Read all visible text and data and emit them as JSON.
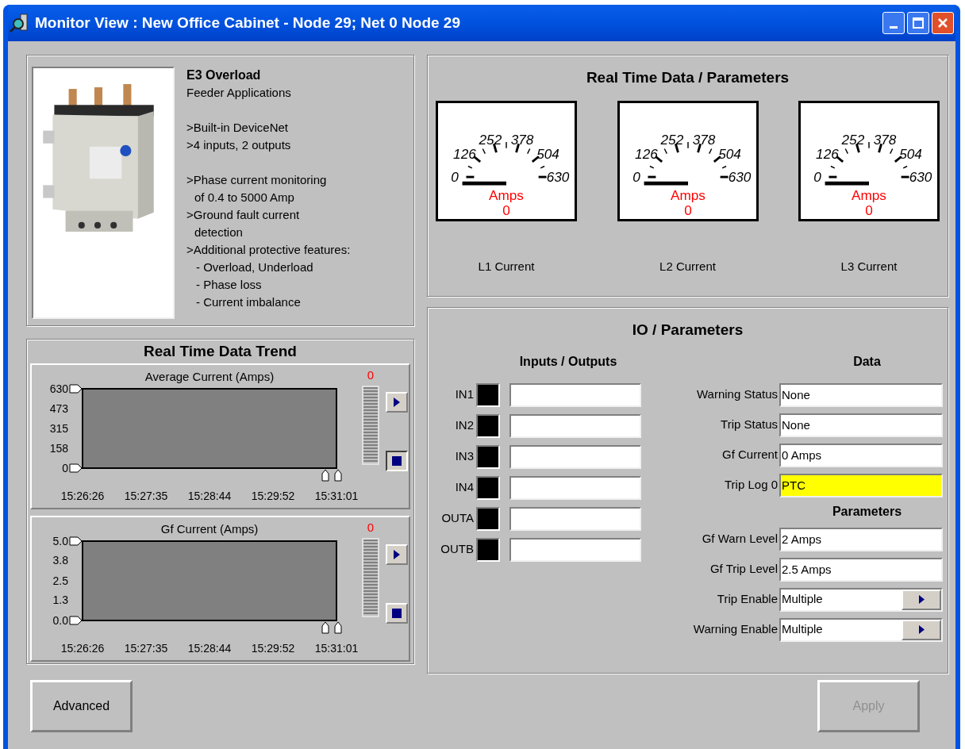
{
  "window": {
    "title": "Monitor View : New Office Cabinet - Node 29; Net 0 Node 29"
  },
  "product": {
    "kind": "picture",
    "name": "E3 Overload",
    "subtitle": "Feeder Applications",
    "groups": [
      [
        {
          "kind": "main",
          "text": ">Built-in DeviceNet"
        },
        {
          "kind": "main",
          "text": ">4 inputs, 2 outputs"
        }
      ],
      [
        {
          "kind": "main",
          "text": ">Phase current monitoring\nof 0.4 to 5000 Amp"
        },
        {
          "kind": "main",
          "text": ">Ground fault current\ndetection"
        },
        {
          "kind": "main",
          "text": ">Additional protective features:"
        },
        {
          "kind": "sub",
          "text": "- Overload, Underload"
        },
        {
          "kind": "sub",
          "text": "- Phase loss"
        },
        {
          "kind": "sub",
          "text": "- Current imbalance"
        }
      ]
    ]
  },
  "realtime": {
    "title": "Real Time Data / Parameters",
    "gauges": [
      {
        "scale": [
          "0",
          "126",
          "252",
          "378",
          "504",
          "630"
        ],
        "unit": "Amps",
        "reading": "0",
        "label": "L1 Current"
      },
      {
        "scale": [
          "0",
          "126",
          "252",
          "378",
          "504",
          "630"
        ],
        "unit": "Amps",
        "reading": "0",
        "label": "L2 Current"
      },
      {
        "scale": [
          "0",
          "126",
          "252",
          "378",
          "504",
          "630"
        ],
        "unit": "Amps",
        "reading": "0",
        "label": "L3 Current"
      }
    ]
  },
  "trend": {
    "title": "Real Time Data Trend",
    "charts": [
      {
        "value": "0",
        "meter": {
          "level": 0
        },
        "play_pressed": false,
        "stop_pressed": true,
        "chart_data": {
          "type": "line",
          "title": "Average Current (Amps)",
          "ylim": [
            0,
            630
          ],
          "yticks": [
            0,
            158,
            315,
            473,
            630
          ],
          "categories": [
            "15:26:26",
            "15:27:35",
            "15:28:44",
            "15:29:52",
            "15:31:01"
          ]
        }
      },
      {
        "value": "0",
        "meter": {
          "level": 0
        },
        "play_pressed": false,
        "stop_pressed": false,
        "chart_data": {
          "type": "line",
          "title": "Gf Current (Amps)",
          "ylim": [
            0,
            5
          ],
          "yticks": [
            {
              "value": 0,
              "label": "0.0"
            },
            {
              "value": 1.3,
              "label": "1.3"
            },
            {
              "value": 2.5,
              "label": "2.5"
            },
            {
              "value": 3.8,
              "label": "3.8"
            },
            {
              "value": 5,
              "label": "5.0"
            }
          ],
          "categories": [
            "15:26:26",
            "15:27:35",
            "15:28:44",
            "15:29:52",
            "15:31:01"
          ]
        }
      }
    ]
  },
  "io": {
    "title": "IO / Parameters",
    "io_heading": "Inputs / Outputs",
    "points": [
      {
        "label": "IN1",
        "on": false
      },
      {
        "label": "IN2",
        "on": false
      },
      {
        "label": "IN3",
        "on": false
      },
      {
        "label": "IN4",
        "on": false
      },
      {
        "label": "OUTA",
        "on": false
      },
      {
        "label": "OUTB",
        "on": false
      }
    ],
    "data_heading": "Data",
    "data": [
      {
        "label": "Warning Status",
        "value": "None",
        "highlighted": false
      },
      {
        "label": "Trip Status",
        "value": "None",
        "highlighted": false
      },
      {
        "label": "Gf Current",
        "value": "0 Amps",
        "highlighted": false
      },
      {
        "label": "Trip Log 0",
        "value": "PTC",
        "highlighted": true
      }
    ],
    "params_heading": "Parameters",
    "params": [
      {
        "kind": "text",
        "label": "Gf Warn Level",
        "value": "2 Amps"
      },
      {
        "kind": "text",
        "label": "Gf Trip Level",
        "value": "2.5 Amps"
      },
      {
        "kind": "select",
        "label": "Trip Enable",
        "value": "Multiple"
      },
      {
        "kind": "select",
        "label": "Warning Enable",
        "value": "Multiple"
      }
    ]
  },
  "buttons": [
    {
      "label": "Advanced",
      "disabled": false
    },
    {
      "label": "Apply",
      "disabled": true
    }
  ]
}
